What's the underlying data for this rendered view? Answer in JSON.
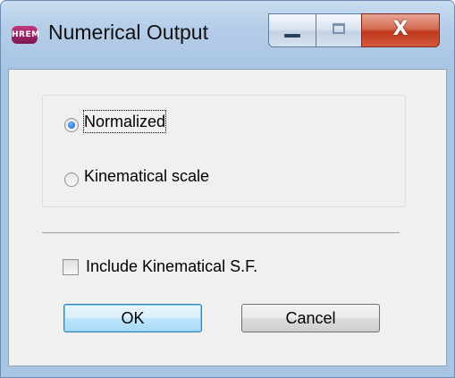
{
  "window": {
    "title": "Numerical Output",
    "icon_text": "HREM",
    "icon": "app-icon",
    "controls": {
      "minimize_icon": "minimize-icon",
      "maximize_icon": "maximize-icon",
      "close_glyph": "X"
    }
  },
  "scale_group": {
    "options": [
      {
        "label": "Normalized",
        "checked": true,
        "focused": true
      },
      {
        "label": "Kinematical scale",
        "checked": false
      }
    ]
  },
  "include_sf": {
    "label": "Include Kinematical S.F.",
    "checked": false
  },
  "buttons": {
    "ok": "OK",
    "cancel": "Cancel"
  },
  "colors": {
    "accent": "#3c7fb1",
    "close": "#c0391e",
    "frame": "#a9c5e4"
  }
}
